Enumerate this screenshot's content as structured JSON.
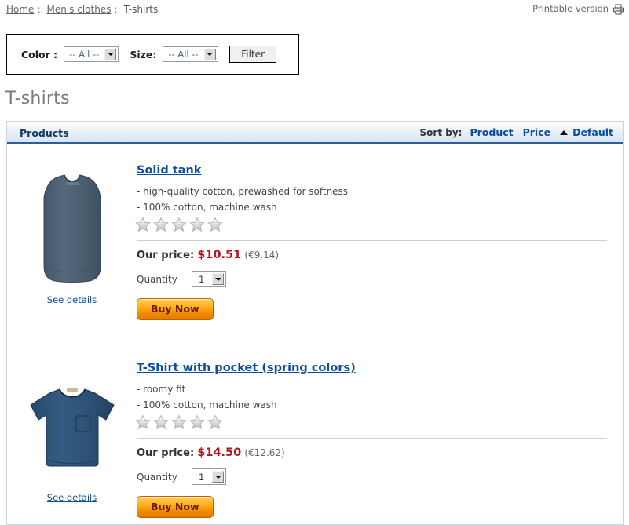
{
  "breadcrumb": {
    "items": [
      {
        "label": "Home",
        "link": true
      },
      {
        "label": "Men's clothes",
        "link": true
      },
      {
        "label": "T-shirts",
        "link": false
      }
    ],
    "separator": "::"
  },
  "header": {
    "printable_label": "Printable version",
    "printer_icon": "printer-icon"
  },
  "filter": {
    "color_label": "Color :",
    "color_value": "-- All --",
    "size_label": "Size:",
    "size_value": "-- All --",
    "button_label": "Filter"
  },
  "page": {
    "title": "T-shirts"
  },
  "panel": {
    "title": "Products",
    "sort": {
      "label": "Sort by:",
      "options": [
        {
          "label": "Product",
          "active": false
        },
        {
          "label": "Price",
          "active": false
        },
        {
          "label": "Default",
          "active": true
        }
      ],
      "active_direction": "asc"
    }
  },
  "products": [
    {
      "name": "Solid tank",
      "details_label": "See details",
      "desc_line1": "- high-quality cotton, prewashed for softness",
      "desc_line2": "- 100% cotton, machine wash",
      "rating": 0,
      "rating_max": 5,
      "price_label": "Our price:",
      "price_main": "$10.51",
      "price_alt": "(€9.14)",
      "quantity_label": "Quantity",
      "quantity_value": "1",
      "buy_label": "Buy Now",
      "image": "tank-top",
      "image_color": "#4e6275"
    },
    {
      "name": "T-Shirt with pocket (spring colors)",
      "details_label": "See details",
      "desc_line1": "- roomy fit",
      "desc_line2": "- 100% cotton, machine wash",
      "rating": 0,
      "rating_max": 5,
      "price_label": "Our price:",
      "price_main": "$14.50",
      "price_alt": "(€12.62)",
      "quantity_label": "Quantity",
      "quantity_value": "1",
      "buy_label": "Buy Now",
      "image": "t-shirt-with-pocket",
      "image_color": "#2f5578"
    }
  ],
  "colors": {
    "link": "#0b4d9e",
    "price": "#b3151a",
    "panel_border": "#2b5d99",
    "buy_button": "#f0a000"
  }
}
